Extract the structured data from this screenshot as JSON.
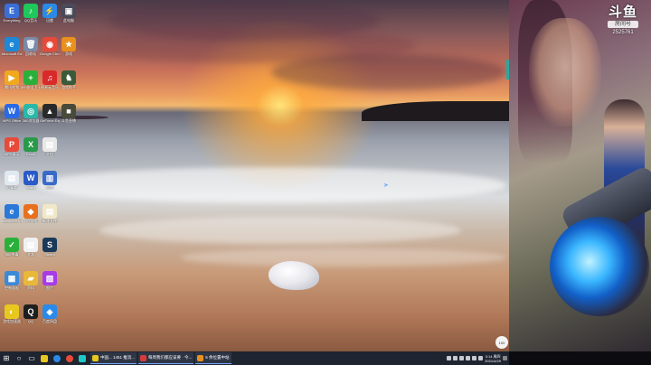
{
  "desktop": {
    "icons": [
      {
        "label": "Everything",
        "color": "#3a6ed8",
        "glyph": "E",
        "col": 0,
        "row": 0
      },
      {
        "label": "QQ音乐",
        "color": "#1ec85a",
        "glyph": "♪",
        "col": 1,
        "row": 0
      },
      {
        "label": "迅雷",
        "color": "#2a8ae8",
        "glyph": "⚡",
        "col": 2,
        "row": 0
      },
      {
        "label": "此电脑",
        "color": "#4a4a5a",
        "glyph": "▣",
        "col": 3,
        "row": 0
      },
      {
        "label": "Microsoft Edge",
        "color": "#1e88d8",
        "glyph": "e",
        "col": 0,
        "row": 1
      },
      {
        "label": "回收站",
        "color": "#7a8aa8",
        "glyph": "🗑",
        "col": 1,
        "row": 1
      },
      {
        "label": "Google Chrome",
        "color": "#e84a3a",
        "glyph": "◉",
        "col": 2,
        "row": 1
      },
      {
        "label": "游戏",
        "color": "#e8901e",
        "glyph": "★",
        "col": 3,
        "row": 1
      },
      {
        "label": "腾讯视频",
        "color": "#f0a81e",
        "glyph": "▶",
        "col": 0,
        "row": 2
      },
      {
        "label": "360安全卫士",
        "color": "#2ab03a",
        "glyph": "+",
        "col": 1,
        "row": 2
      },
      {
        "label": "网易云音乐",
        "color": "#d82a2a",
        "glyph": "♫",
        "col": 2,
        "row": 2
      },
      {
        "label": "游戏助手",
        "color": "#3a5a3a",
        "glyph": "♞",
        "col": 3,
        "row": 2
      },
      {
        "label": "WPS Office",
        "color": "#2a6ae8",
        "glyph": "W",
        "col": 0,
        "row": 3
      },
      {
        "label": "360浏览器",
        "color": "#2ab8a8",
        "glyph": "◎",
        "col": 1,
        "row": 3
      },
      {
        "label": "GeForce Experience",
        "color": "#2a2a2a",
        "glyph": "▲",
        "col": 2,
        "row": 3
      },
      {
        "label": "斗鱼直播",
        "color": "#4a4a3a",
        "glyph": "■",
        "col": 3,
        "row": 3
      },
      {
        "label": "WPS演示",
        "color": "#e84a3a",
        "glyph": "P",
        "col": 0,
        "row": 4
      },
      {
        "label": "Excel",
        "color": "#2a9a4a",
        "glyph": "X",
        "col": 1,
        "row": 4
      },
      {
        "label": "文档",
        "color": "#e8e8e8",
        "glyph": "▤",
        "col": 2,
        "row": 4
      },
      {
        "label": "记事本",
        "color": "#e0e8f0",
        "glyph": "▤",
        "col": 0,
        "row": 5
      },
      {
        "label": "Word",
        "color": "#2a5ac8",
        "glyph": "W",
        "col": 1,
        "row": 5
      },
      {
        "label": "设置",
        "color": "#3a6ac8",
        "glyph": "▥",
        "col": 2,
        "row": 5
      },
      {
        "label": "Internet Explorer",
        "color": "#2a78d8",
        "glyph": "e",
        "col": 0,
        "row": 6
      },
      {
        "label": "QQ游戏",
        "color": "#e8701e",
        "glyph": "◆",
        "col": 1,
        "row": 6
      },
      {
        "label": "新建文件",
        "color": "#f0e8c8",
        "glyph": "▤",
        "col": 2,
        "row": 6
      },
      {
        "label": "360杀毒",
        "color": "#2ab03a",
        "glyph": "✓",
        "col": 0,
        "row": 7
      },
      {
        "label": "文本",
        "color": "#f0f0f0",
        "glyph": "▤",
        "col": 1,
        "row": 7
      },
      {
        "label": "Steam",
        "color": "#1a3a5a",
        "glyph": "S",
        "col": 2,
        "row": 7
      },
      {
        "label": "控制面板",
        "color": "#3a8ad8",
        "glyph": "▦",
        "col": 0,
        "row": 8
      },
      {
        "label": "资料",
        "color": "#e8b83a",
        "glyph": "▰",
        "col": 1,
        "row": 8
      },
      {
        "label": "图片",
        "color": "#a83ae8",
        "glyph": "▧",
        "col": 2,
        "row": 8
      },
      {
        "label": "游戏加速器",
        "color": "#e8c81e",
        "glyph": "◐",
        "col": 0,
        "row": 9
      },
      {
        "label": "QQ",
        "color": "#1e1e1e",
        "glyph": "Q",
        "col": 1,
        "row": 9
      },
      {
        "label": "百度网盘",
        "color": "#2a8ae8",
        "glyph": "◈",
        "col": 2,
        "row": 9
      }
    ]
  },
  "stream_panel": {
    "logo_mark": "斗鱼",
    "logo_sub": "房间号",
    "room_id": "2525761"
  },
  "taskbar": {
    "start_glyph": "⊞",
    "search_glyph": "○",
    "taskview_glyph": "▭",
    "apps": [
      {
        "label": "中国... 1451 推流...",
        "color": "#e8c81e"
      },
      {
        "label": "每周我们都应该要 · 今...",
        "color": "#d83a3a"
      },
      {
        "label": "5 余位置中站",
        "color": "#e8901e"
      }
    ],
    "clock_time": "3:14 周四",
    "clock_date": "2021/4/29",
    "float_label": "100"
  }
}
